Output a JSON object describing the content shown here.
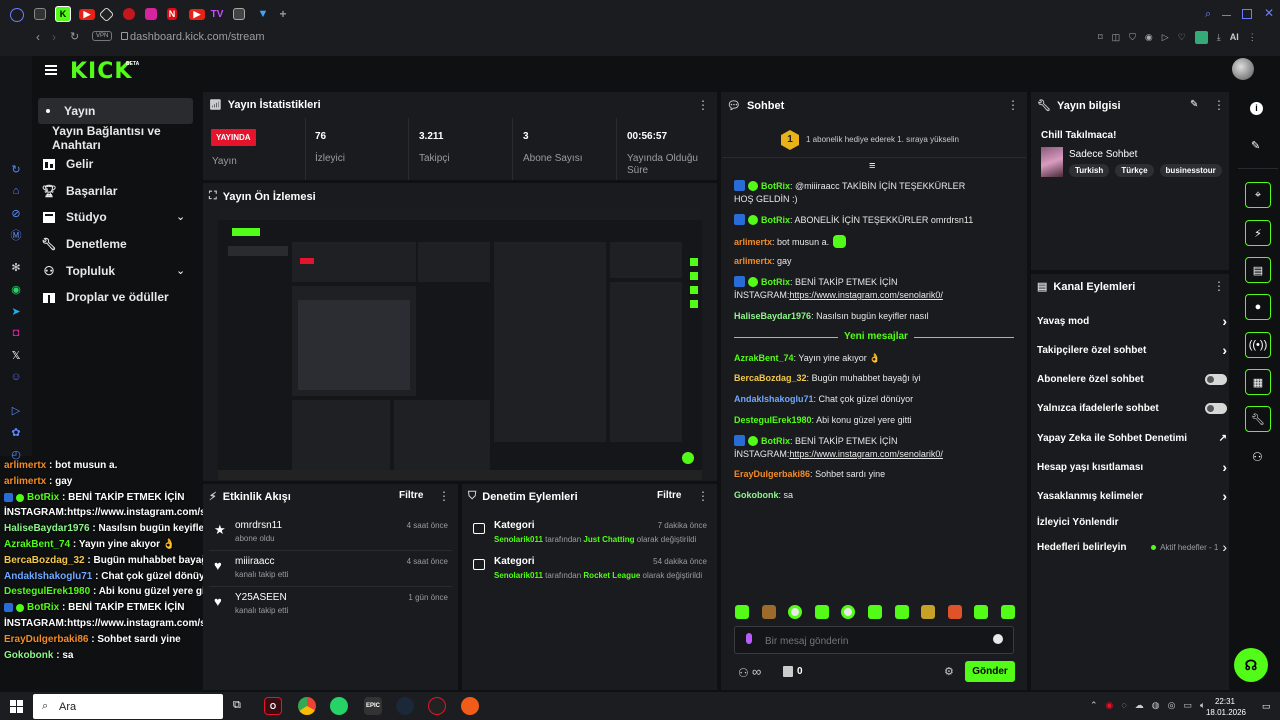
{
  "browser": {
    "url": "dashboard.kick.com/stream",
    "vpn_label": "VPN",
    "ai_label": "AI",
    "tab_tv_label": "TV"
  },
  "header": {
    "logo": "KICK",
    "beta": "BETA"
  },
  "sidebar": {
    "items": [
      {
        "label": "Yayın"
      },
      {
        "label": "Yayın Bağlantısı ve Anahtarı"
      },
      {
        "label": "Gelir"
      },
      {
        "label": "Başarılar"
      },
      {
        "label": "Stüdyo"
      },
      {
        "label": "Denetleme"
      },
      {
        "label": "Topluluk"
      },
      {
        "label": "Droplar ve ödüller"
      }
    ]
  },
  "stats": {
    "title": "Yayın İstatistikleri",
    "live_badge": "YAYINDA",
    "live_label": "Yayın",
    "viewers_value": "76",
    "viewers_label": "İzleyici",
    "followers_value": "3.211",
    "followers_label": "Takipçi",
    "subs_value": "3",
    "subs_label": "Abone Sayısı",
    "uptime_value": "00:56:57",
    "uptime_label_1": "Yayında Olduğu",
    "uptime_label_2": "Süre"
  },
  "preview": {
    "title": "Yayın Ön İzlemesi"
  },
  "activity": {
    "title": "Etkinlik Akışı",
    "filter": "Filtre",
    "items": [
      {
        "user": "omrdrsn11",
        "action": "abone oldu",
        "time": "4 saat önce"
      },
      {
        "user": "miiiraacc",
        "action": "kanalı takip etti",
        "time": "4 saat önce"
      },
      {
        "user": "Y25ASEEN",
        "action": "kanalı takip etti",
        "time": "1 gün önce"
      }
    ]
  },
  "moderation": {
    "title": "Denetim Eylemleri",
    "filter": "Filtre",
    "items": [
      {
        "title": "Kategori",
        "time": "7 dakika önce",
        "actor": "Senolarik011",
        "mid": " tarafından ",
        "target": "Just Chatting",
        "end": " olarak değiştirildi"
      },
      {
        "title": "Kategori",
        "time": "54 dakika önce",
        "actor": "Senolarik011",
        "mid": " tarafından ",
        "target": "Rocket League",
        "end": " olarak değiştirildi"
      }
    ]
  },
  "chat": {
    "title": "Sohbet",
    "gift_banner": "1 abonelik hediye ederek 1. sıraya yükselin",
    "gift_rank": "1",
    "new_messages": "Yeni mesajlar",
    "messages": [
      {
        "user": "BotRix",
        "color": "#53fc18",
        "text": "@miiiraacc TAKİBİN İÇİN TEŞEKKÜRLER HOŞ GELDİN :)",
        "bot": true
      },
      {
        "user": "BotRix",
        "color": "#53fc18",
        "text": "ABONELİK İÇİN TEŞEKKÜRLER omrdrsn11",
        "bot": true
      },
      {
        "user": "arlimertx",
        "color": "#f28c28",
        "text": "bot musun a.",
        "bot": false
      },
      {
        "user": "arlimertx",
        "color": "#f28c28",
        "text": "gay",
        "bot": false
      },
      {
        "user": "BotRix",
        "color": "#53fc18",
        "text": "BENİ TAKİP ETMEK İÇİN İNSTAGRAM:",
        "link": "https://www.instagram.com/senolarik0/",
        "bot": true
      },
      {
        "user": "HaliseBaydar1976",
        "color": "#8ef58a",
        "text": "Nasılsın bugün keyifler nasıl",
        "bot": false
      },
      {
        "user": "AzrakBent_74",
        "color": "#53fc18",
        "text": "Yayın yine akıyor 👌",
        "bot": false
      },
      {
        "user": "BercaBozdag_32",
        "color": "#f2c94c",
        "text": "Bugün muhabbet bayağı iyi",
        "bot": false
      },
      {
        "user": "AndakIshakoglu71",
        "color": "#6fa8ff",
        "text": "Chat çok güzel dönüyor",
        "bot": false
      },
      {
        "user": "DestegulErek1980",
        "color": "#53fc18",
        "text": "Abi konu güzel yere gitti",
        "bot": false
      },
      {
        "user": "BotRix",
        "color": "#53fc18",
        "text": "BENİ TAKİP ETMEK İÇİN İNSTAGRAM:",
        "link": "https://www.instagram.com/senolarik0/",
        "bot": true
      },
      {
        "user": "ErayDulgerbaki86",
        "color": "#f28c28",
        "text": "Sohbet sardı yine",
        "bot": false
      },
      {
        "user": "Gokobonk",
        "color": "#8ef58a",
        "text": "sa",
        "bot": false
      }
    ],
    "input_placeholder": "Bir mesaj gönderin",
    "infinity": "∞",
    "count": "0",
    "send": "Gönder"
  },
  "stream_info": {
    "title": "Yayın bilgisi",
    "stream_title": "Chill Takılmaca!",
    "category": "Sadece Sohbet",
    "tags": [
      "Turkish",
      "Türkçe",
      "businesstour"
    ]
  },
  "channel_actions": {
    "title": "Kanal Eylemleri",
    "items": [
      {
        "label": "Yavaş mod",
        "kind": "chevron"
      },
      {
        "label": "Takipçilere özel sohbet",
        "kind": "chevron"
      },
      {
        "label": "Abonelere özel sohbet",
        "kind": "toggle"
      },
      {
        "label": "Yalnızca ifadelerle sohbet",
        "kind": "toggle"
      },
      {
        "label": "Yapay Zeka ile Sohbet Denetimi",
        "kind": "external"
      },
      {
        "label": "Hesap yaşı kısıtlaması",
        "kind": "chevron"
      },
      {
        "label": "Yasaklanmış kelimeler",
        "kind": "chevron"
      },
      {
        "label": "İzleyici Yönlendir",
        "kind": "none"
      },
      {
        "label": "Hedefleri belirleyin",
        "kind": "goals"
      }
    ],
    "active_goals": "Aktif hedefler - 1"
  },
  "overlay_chat": [
    {
      "user": "arlimertx",
      "color": "#f28c28",
      "text": "bot musun a."
    },
    {
      "user": "arlimertx",
      "color": "#f28c28",
      "text": "gay"
    },
    {
      "user": "BotRix",
      "color": "#53fc18",
      "text": "BENİ TAKİP ETMEK İÇİN"
    },
    {
      "user": "",
      "color": "#ffffff",
      "text": "İNSTAGRAM:https://www.instagram.com/senolarik0/"
    },
    {
      "user": "HaliseBaydar1976",
      "color": "#8ef58a",
      "text": "Nasılsın bugün keyifler nasıl"
    },
    {
      "user": "AzrakBent_74",
      "color": "#53fc18",
      "text": "Yayın yine akıyor 👌"
    },
    {
      "user": "BercaBozdag_32",
      "color": "#f2c94c",
      "text": "Bugün muhabbet bayağı iyi"
    },
    {
      "user": "AndakIshakoglu71",
      "color": "#6fa8ff",
      "text": "Chat çok güzel dönüyor"
    },
    {
      "user": "DestegulErek1980",
      "color": "#53fc18",
      "text": "Abi konu güzel yere gitti"
    },
    {
      "user": "BotRix",
      "color": "#53fc18",
      "text": "BENİ TAKİP ETMEK İÇİN"
    },
    {
      "user": "",
      "color": "#ffffff",
      "text": "İNSTAGRAM:https://www.instagram.com/senolarik0/"
    },
    {
      "user": "ErayDulgerbaki86",
      "color": "#f28c28",
      "text": "Sohbet sardı yine"
    },
    {
      "user": "Gokobonk",
      "color": "#8ef58a",
      "text": "sa"
    }
  ],
  "taskbar": {
    "search": "Ara",
    "time": "22:31",
    "date": "18.01.2026"
  },
  "colors": {
    "accent": "#53fc18",
    "live": "#e5132b"
  }
}
